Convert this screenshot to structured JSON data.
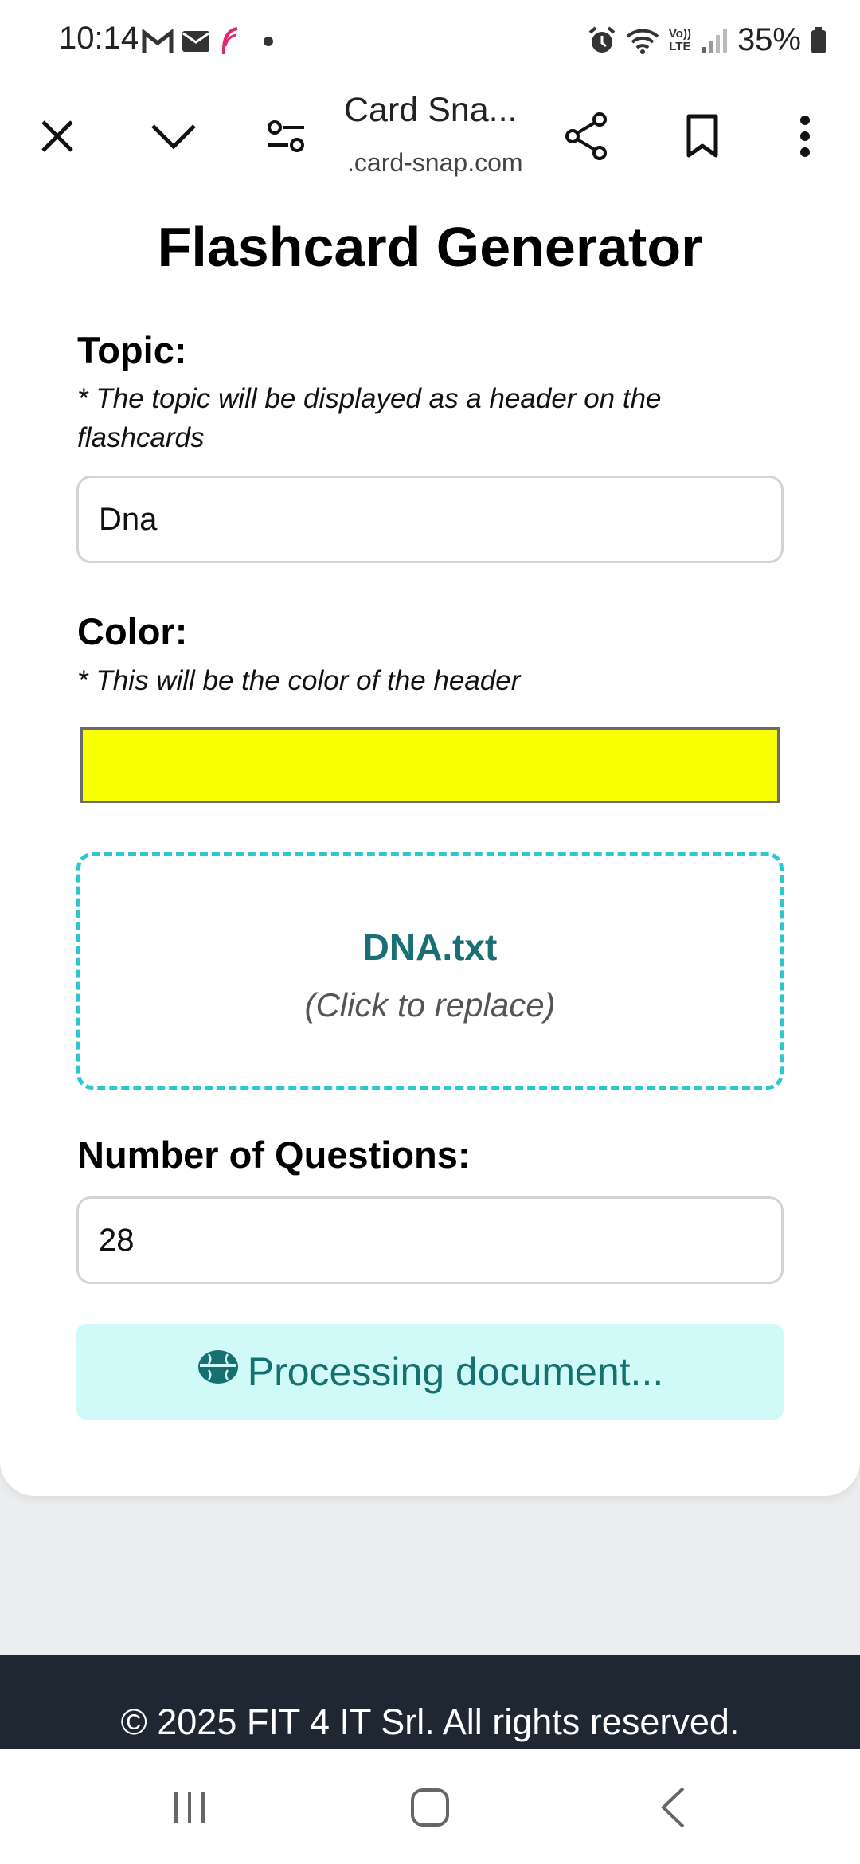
{
  "status_bar": {
    "time": "10:14",
    "battery": "35%",
    "icons_left": [
      "gmail-icon",
      "mail-icon",
      "feather-app-icon",
      "dot-icon"
    ],
    "icons_right": [
      "alarm-icon",
      "wifi-icon",
      "volte-icon",
      "signal-icon",
      "battery-icon"
    ],
    "volte_label_top": "Vo))",
    "volte_label_bottom": "LTE"
  },
  "browser": {
    "title": "Card Sna...",
    "url": ".card-snap.com",
    "buttons": [
      "close-icon",
      "chevron-down-icon",
      "page-controls-icon",
      "share-icon",
      "bookmark-icon",
      "more-vert-icon"
    ]
  },
  "form": {
    "title": "Flashcard Generator",
    "topic_label": "Topic:",
    "topic_hint": "* The topic will be displayed as a header on the flashcards",
    "topic_value": "Dna",
    "color_label": "Color:",
    "color_hint": "* This will be the color of the header",
    "color_value": "#f8ff00",
    "file_name": "DNA.txt",
    "file_hint": "(Click to replace)",
    "questions_label": "Number of Questions:",
    "questions_value": "28",
    "status_text": "Processing document...",
    "status_icon": "brain-icon"
  },
  "footer": {
    "copyright": "© 2025 FIT 4 IT Srl. All rights reserved."
  },
  "colors": {
    "accent": "#2cc8d2",
    "status_bg": "#cffaf8",
    "status_text": "#16706f",
    "footer_bg": "#1f2733"
  }
}
